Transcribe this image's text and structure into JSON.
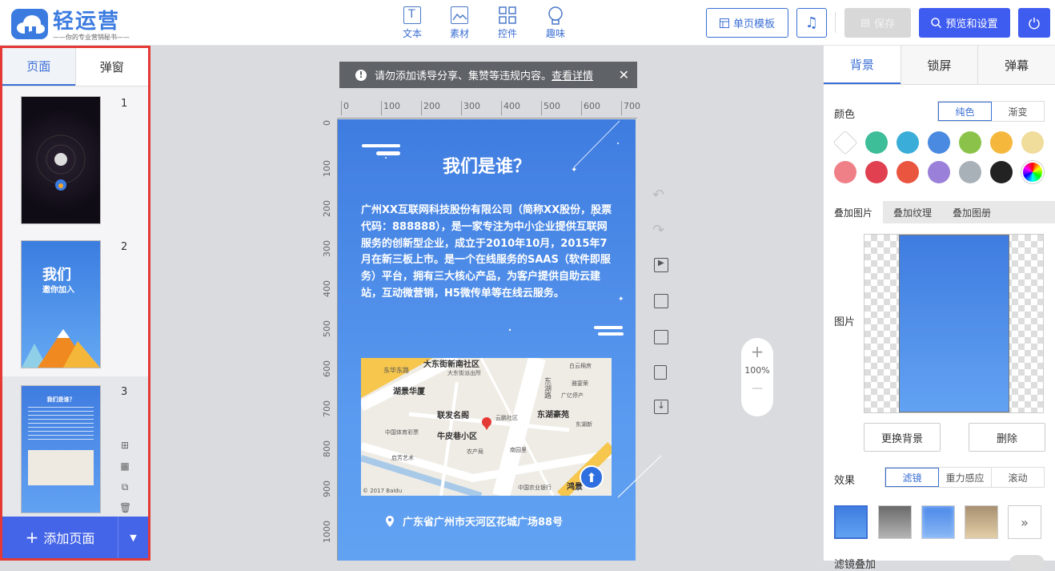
{
  "app": {
    "name": "轻运营",
    "slogan": "——你的专业营销秘书——"
  },
  "toolbar": {
    "tools": [
      {
        "label": "文本",
        "icon": "text-icon"
      },
      {
        "label": "素材",
        "icon": "image-icon"
      },
      {
        "label": "控件",
        "icon": "widgets-icon"
      },
      {
        "label": "趣味",
        "icon": "bulb-icon"
      }
    ],
    "single_page_template": "单页模板",
    "music_icon": "music-icon",
    "save": "保存",
    "preview": "预览和设置",
    "power_icon": "power-icon"
  },
  "left_panel": {
    "tabs": [
      "页面",
      "弹窗"
    ],
    "active_tab": "页面",
    "pages": [
      {
        "num": "1",
        "thumb_title": ""
      },
      {
        "num": "2",
        "thumb_title": "我们",
        "thumb_subtitle": "邀你加入"
      },
      {
        "num": "3",
        "thumb_title": "我们是谁？"
      }
    ],
    "add_page": "添加页面"
  },
  "notice": {
    "text": "请勿添加诱导分享、集赞等违规内容。",
    "link": "查看详情"
  },
  "ruler": {
    "top_ticks": [
      "0",
      "100",
      "200",
      "300",
      "400",
      "500",
      "600",
      "700"
    ],
    "left_ticks": [
      "0",
      "100",
      "200",
      "300",
      "400",
      "500",
      "600",
      "700",
      "800",
      "900",
      "1000"
    ]
  },
  "stage": {
    "title": "我们是谁？",
    "body": "广州XX互联网科技股份有限公司（简称XX股份，股票代码：888888），是一家专注为中小企业提供互联网服务的创新型企业，成立于2010年10月，2015年7月在新三板上市。是一个在线服务的SAAS（软件即服务）平台，拥有三大核心产品，为客户提供自助云建站，互动微营销，H5微传单等在线云服务。",
    "map": {
      "labels": [
        "大东街新南社区",
        "湖景华厦",
        "联发名阁",
        "牛皮巷小区",
        "东湖豪苑",
        "东湖路",
        "东华东路",
        "大东街派出所",
        "白云棉房",
        "雅宴荣",
        "广亿停产",
        "农产局",
        "南园里",
        "云鹏社区",
        "中国体育彩票",
        "启芳艺术",
        "中国农业银行",
        "鸿景",
        "东湖新",
        "© 2017 Baidu"
      ],
      "copyright": "© 2017 Baidu"
    },
    "address": "广东省广州市天河区花城广场88号"
  },
  "zoom": {
    "level": "100%",
    "plus": "+",
    "minus": "—"
  },
  "right_panel": {
    "tabs": [
      "背景",
      "锁屏",
      "弹幕"
    ],
    "active_tab": "背景",
    "color_label": "颜色",
    "color_modes": [
      "纯色",
      "渐变"
    ],
    "swatches": [
      "#ffffff",
      "#3dbd98",
      "#3aaed8",
      "#4a8ae0",
      "#8bc34a",
      "#f5b83d",
      "#f0dc9b",
      "#f08088",
      "#e04050",
      "#ea5540",
      "#9a80d8",
      "#a8b0b8",
      "#222222",
      "rainbow"
    ],
    "overlay_tabs": [
      "叠加图片",
      "叠加纹理",
      "叠加图册"
    ],
    "image_label": "图片",
    "change_bg": "更换背景",
    "delete": "删除",
    "effect_label": "效果",
    "effect_modes": [
      "滤镜",
      "重力感应",
      "滚动"
    ],
    "more": "»",
    "overlay_label": "滤镜叠加"
  }
}
